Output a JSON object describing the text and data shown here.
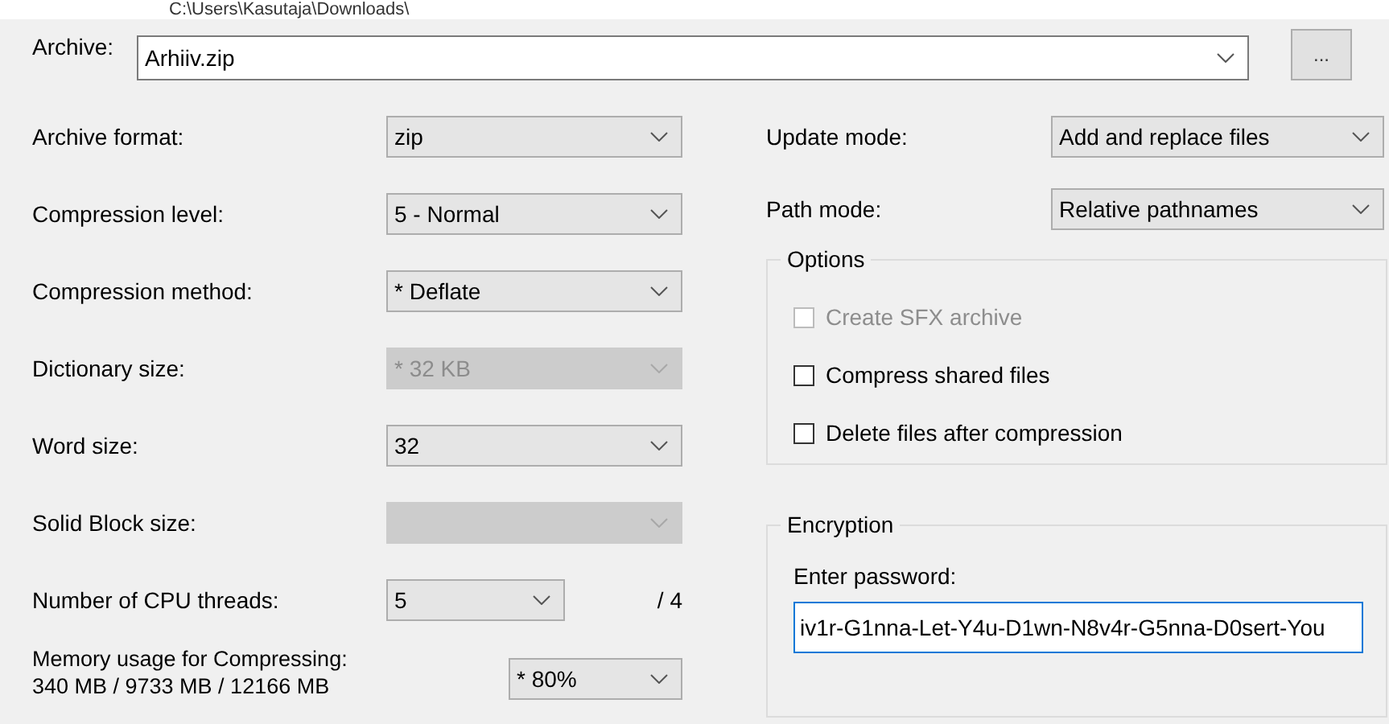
{
  "archive": {
    "label": "Archive:",
    "path": "C:\\Users\\Kasutaja\\Downloads\\",
    "value": "Arhiiv.zip",
    "browse_button": "..."
  },
  "left_settings": [
    {
      "kind": "combo",
      "label": "Archive format:",
      "value": "zip",
      "disabled": false
    },
    {
      "kind": "combo",
      "label": "Compression level:",
      "value": "5 - Normal",
      "disabled": false
    },
    {
      "kind": "combo",
      "label": "Compression method:",
      "value": "*  Deflate",
      "disabled": false
    },
    {
      "kind": "combo",
      "label": "Dictionary size:",
      "value": "*  32 KB",
      "disabled": true
    },
    {
      "kind": "combo",
      "label": "Word size:",
      "value": "32",
      "disabled": false
    },
    {
      "kind": "combo",
      "label": "Solid Block size:",
      "disabled": true
    },
    {
      "kind": "threads",
      "label": "Number of CPU threads:",
      "value": "5",
      "disabled": false,
      "suffix": "/ 4"
    },
    {
      "kind": "memory",
      "label": "Memory usage for Compressing:",
      "detail": "340 MB / 9733 MB / 12166 MB",
      "value": "* 80%",
      "disabled": false
    }
  ],
  "right_settings": [
    {
      "label": "Update mode:",
      "value": "Add and replace files",
      "disabled": false
    },
    {
      "label": "Path mode:",
      "value": "Relative pathnames",
      "disabled": false
    }
  ],
  "options": {
    "title": "Options",
    "checkboxes": [
      {
        "label": "Create SFX archive",
        "checked": false,
        "disabled": true
      },
      {
        "label": "Compress shared files",
        "checked": false,
        "disabled": false
      },
      {
        "label": "Delete files after compression",
        "checked": false,
        "disabled": false
      }
    ]
  },
  "encryption": {
    "title": "Encryption",
    "password_label": "Enter password:",
    "password": "iv1r-G1nna-Let-Y4u-D1wn-N8v4r-G5nna-D0sert-You"
  }
}
